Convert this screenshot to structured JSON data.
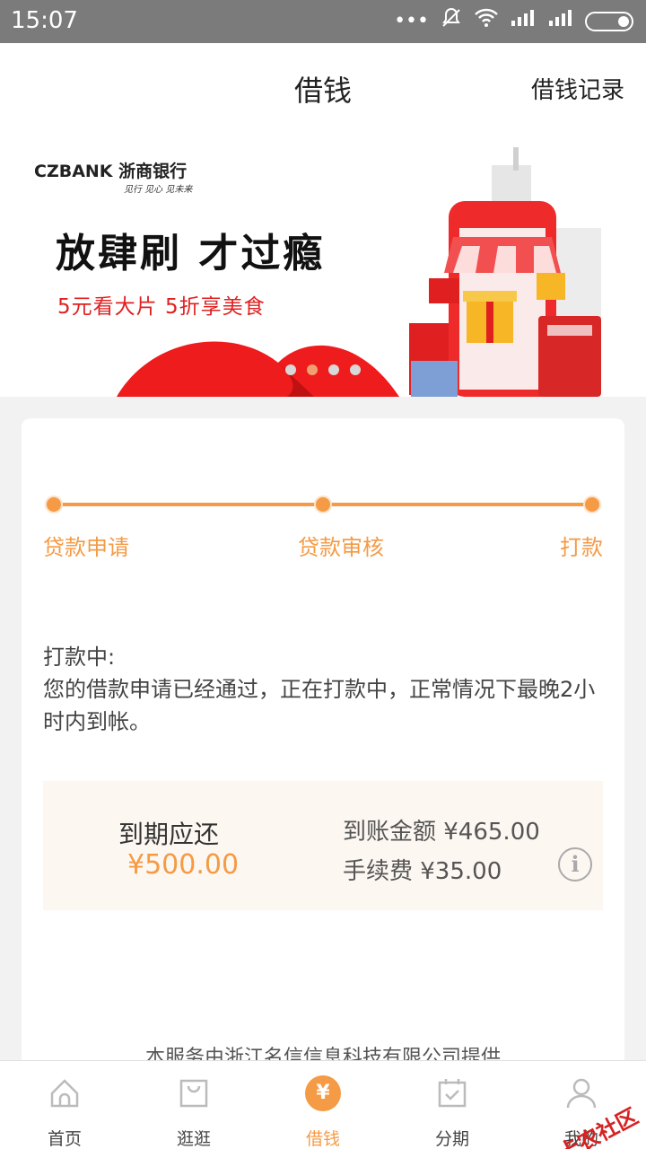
{
  "status_bar": {
    "time": "15:07",
    "icons": [
      "more-dots-icon",
      "mute-icon",
      "wifi-icon",
      "signal-icon",
      "signal-icon",
      "battery-icon"
    ]
  },
  "header": {
    "title": "借钱",
    "record_link": "借钱记录"
  },
  "banner": {
    "bank_name": "CZBANK 浙商银行",
    "slogan": "见行 见心 见未来",
    "headline": "放肆刷 才过瘾",
    "subline": "5元看大片 5折享美食",
    "dots_total": 4,
    "dot_active_index": 1
  },
  "progress": {
    "steps": [
      "贷款申请",
      "贷款审核",
      "打款"
    ],
    "current_step": 3
  },
  "status": {
    "title": "打款中:",
    "message": "您的借款申请已经通过，正在打款中，正常情况下最晚2小时内到帐。"
  },
  "amounts": {
    "due_label": "到期应还",
    "due_amount": "¥500.00",
    "received": "到账金额 ¥465.00",
    "fee": "手续费 ¥35.00"
  },
  "footer_note": "本服务由浙江名信信息科技有限公司提供",
  "nav": {
    "items": [
      {
        "label": "首页",
        "icon": "home-icon"
      },
      {
        "label": "逛逛",
        "icon": "bag-icon"
      },
      {
        "label": "借钱",
        "icon": "yen-icon"
      },
      {
        "label": "分期",
        "icon": "calendar-check-icon"
      },
      {
        "label": "我的",
        "icon": "user-icon"
      }
    ],
    "active_index": 2
  },
  "watermark": "卡农社区",
  "colors": {
    "accent": "#f59a45",
    "banner_red": "#e02020",
    "status_bar": "#7b7b7b"
  }
}
